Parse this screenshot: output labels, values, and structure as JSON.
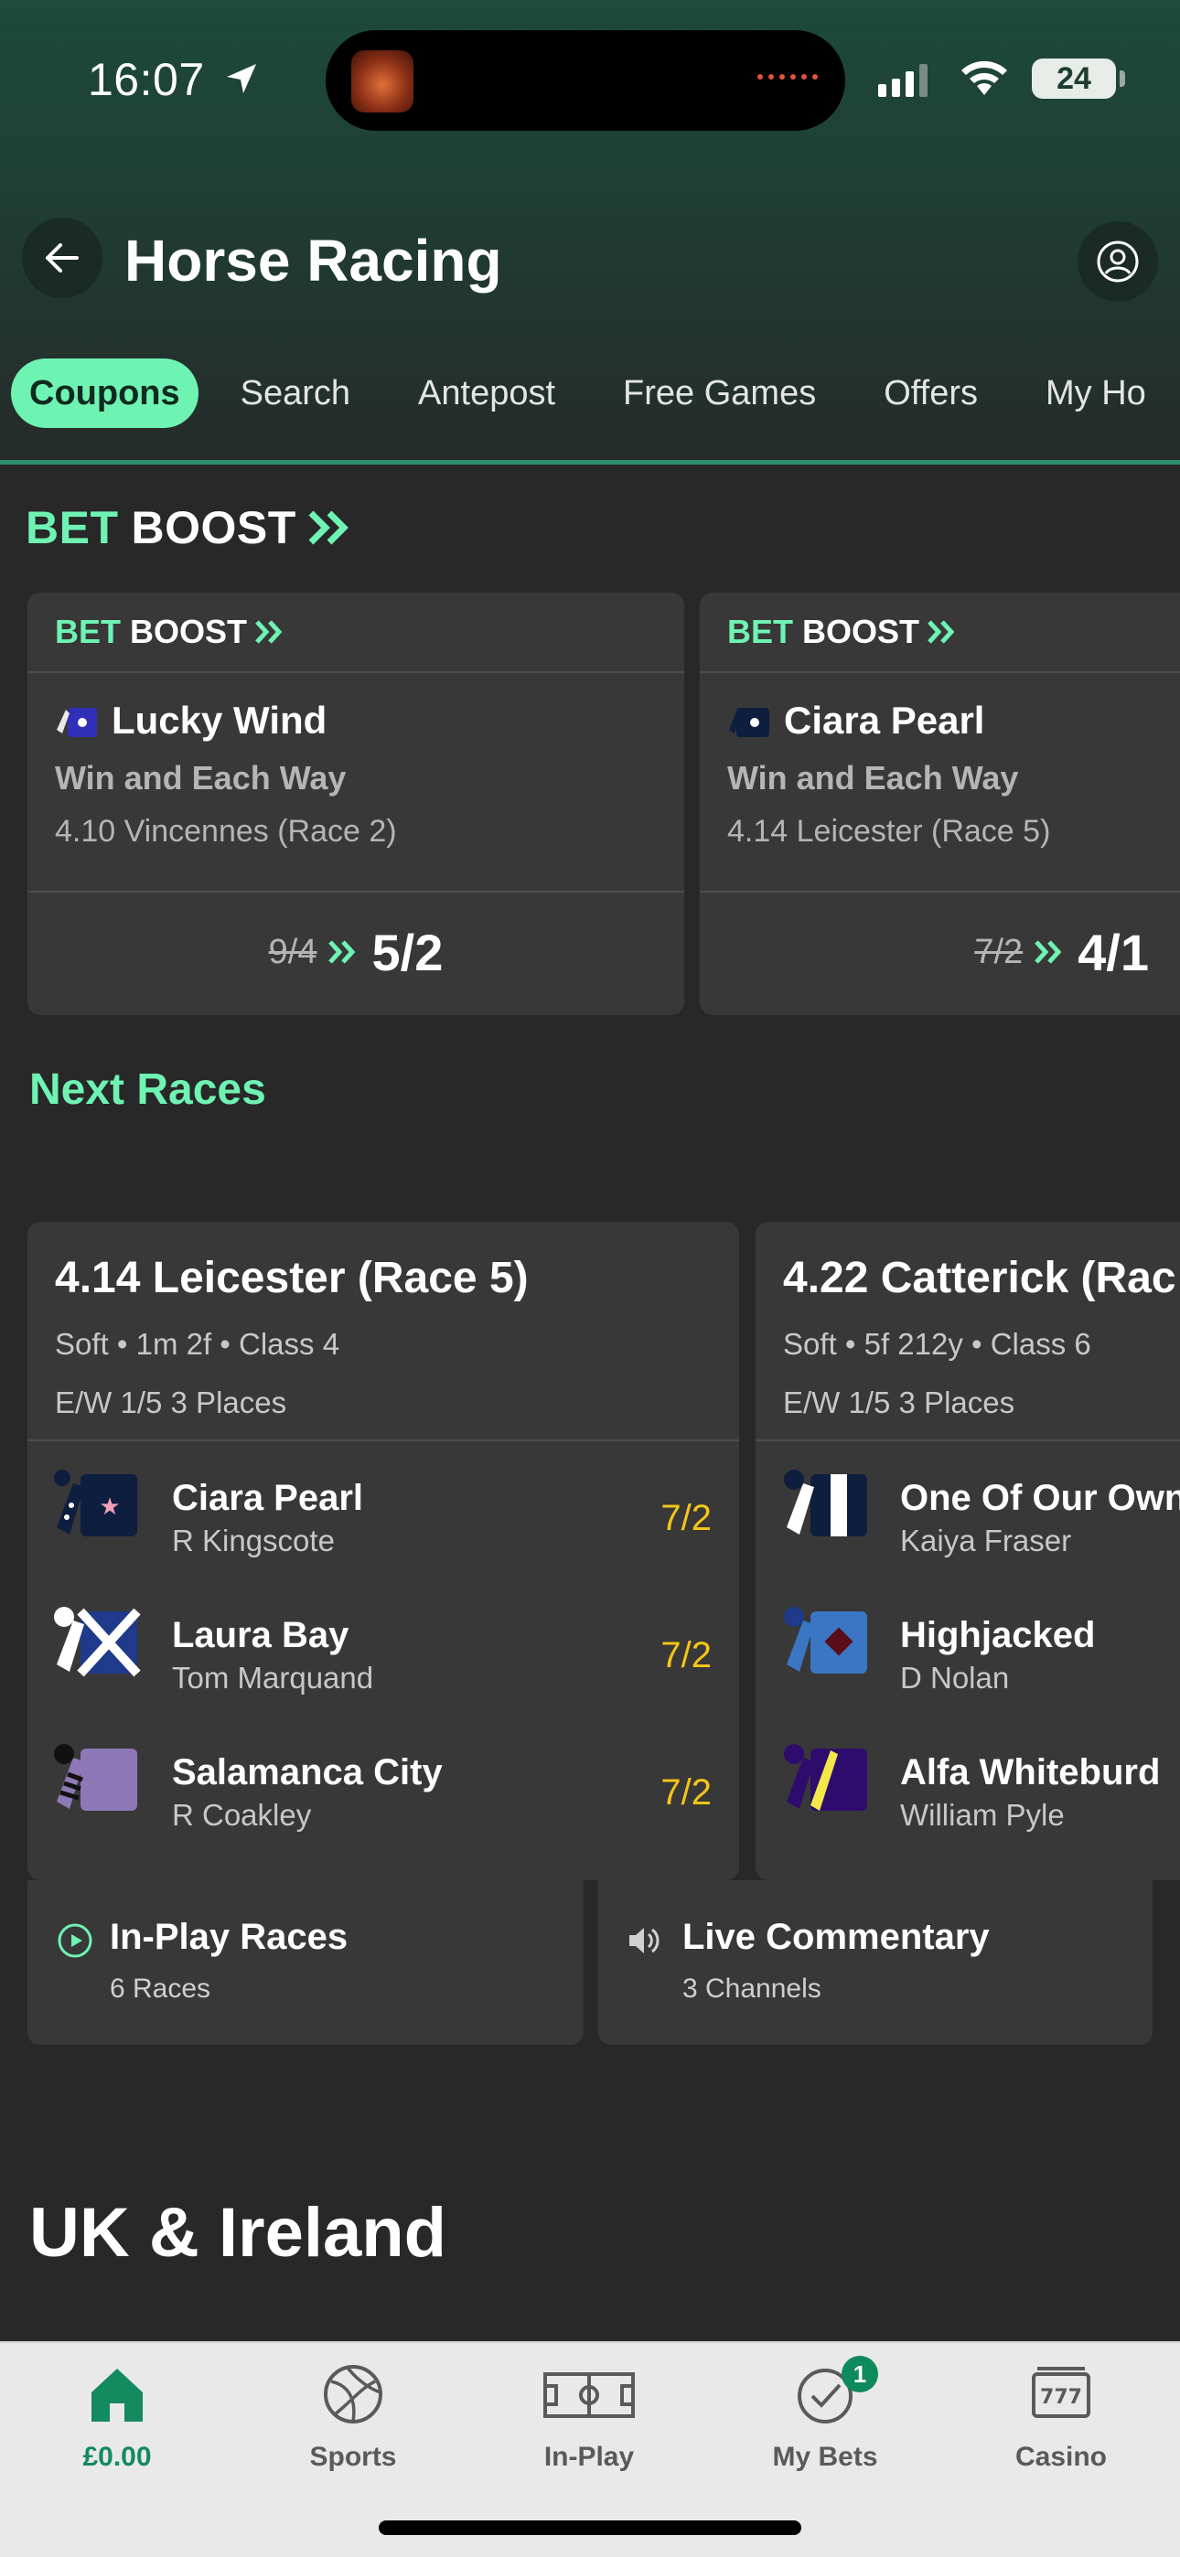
{
  "status_bar": {
    "time": "16:07",
    "battery": "24"
  },
  "header": {
    "title": "Horse Racing"
  },
  "tabs": [
    {
      "label": "Coupons",
      "active": true
    },
    {
      "label": "Search"
    },
    {
      "label": "Antepost"
    },
    {
      "label": "Free Games"
    },
    {
      "label": "Offers"
    },
    {
      "label": "My Ho"
    }
  ],
  "bet_boost": {
    "heading_green": "BET",
    "heading_white": "BOOST",
    "cards": [
      {
        "label_green": "BET",
        "label_white": "BOOST",
        "runner": "Lucky Wind",
        "market": "Win and Each Way",
        "race": "4.10 Vincennes (Race 2)",
        "old_odds": "9/4",
        "new_odds": "5/2"
      },
      {
        "label_green": "BET",
        "label_white": "BOOST",
        "runner": "Ciara Pearl",
        "market": "Win and Each Way",
        "race": "4.14 Leicester (Race 5)",
        "old_odds": "7/2",
        "new_odds": "4/1"
      }
    ]
  },
  "next_races": {
    "heading": "Next Races",
    "races": [
      {
        "title": "4.14 Leicester (Race 5)",
        "info": "Soft • 1m 2f • Class 4",
        "each_way": "E/W 1/5 3 Places",
        "runners": [
          {
            "name": "Ciara Pearl",
            "jockey": "R Kingscote",
            "odds": "7/2"
          },
          {
            "name": "Laura Bay",
            "jockey": "Tom Marquand",
            "odds": "7/2"
          },
          {
            "name": "Salamanca City",
            "jockey": "R Coakley",
            "odds": "7/2"
          }
        ]
      },
      {
        "title": "4.22 Catterick (Rac",
        "info": "Soft • 5f 212y • Class 6",
        "each_way": "E/W 1/5 3 Places",
        "runners": [
          {
            "name": "One Of Our Own",
            "jockey": "Kaiya Fraser",
            "odds": ""
          },
          {
            "name": "Highjacked",
            "jockey": "D Nolan",
            "odds": ""
          },
          {
            "name": "Alfa Whiteburd",
            "jockey": "William Pyle",
            "odds": ""
          }
        ]
      }
    ]
  },
  "quick_links": [
    {
      "title": "In-Play Races",
      "subtitle": "6 Races",
      "icon": "play-circle-icon"
    },
    {
      "title": "Live Commentary",
      "subtitle": "3 Channels",
      "icon": "speaker-icon"
    }
  ],
  "section_title": "UK & Ireland",
  "bottom_nav": [
    {
      "label": "£0.00",
      "icon": "home-icon",
      "active": true
    },
    {
      "label": "Sports",
      "icon": "ball-icon"
    },
    {
      "label": "In-Play",
      "icon": "pitch-icon"
    },
    {
      "label": "My Bets",
      "icon": "check-circle-icon",
      "badge": "1"
    },
    {
      "label": "Casino",
      "icon": "slot-machine-icon"
    }
  ],
  "colors": {
    "accent": "#6ff3b3",
    "odds": "#f5c518",
    "card": "#383838",
    "background": "#282828"
  }
}
